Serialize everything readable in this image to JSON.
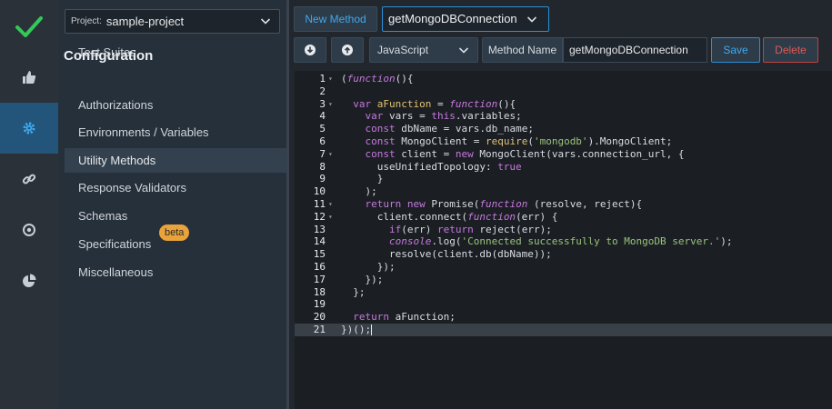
{
  "rail": {
    "items": [
      {
        "icon": "check-icon"
      },
      {
        "icon": "thumbs-up-icon"
      },
      {
        "icon": "gear-icon"
      },
      {
        "icon": "link-icon"
      },
      {
        "icon": "target-icon"
      },
      {
        "icon": "pie-chart-icon"
      }
    ]
  },
  "project": {
    "label": "Project:",
    "value": "sample-project"
  },
  "nav": {
    "heading": "Configuration",
    "items": [
      {
        "label": "Test Suites"
      },
      {
        "label": "Authorizations"
      },
      {
        "label": "Environments / Variables"
      },
      {
        "label": "Utility Methods"
      },
      {
        "label": "Response Validators"
      },
      {
        "label": "Schemas"
      },
      {
        "label": "Specifications",
        "badge": "beta"
      },
      {
        "label": "Miscellaneous"
      }
    ]
  },
  "toolbar": {
    "new_method": "New Method",
    "method_select": "getMongoDBConnection",
    "language": "JavaScript",
    "method_name_label": "Method Name",
    "method_name_value": "getMongoDBConnection",
    "save": "Save",
    "delete": "Delete"
  },
  "editor": {
    "lines": [
      "(function(){",
      "",
      "  var aFunction = function(){",
      "    var vars = this.variables;",
      "    const dbName = vars.db_name;",
      "    const MongoClient = require('mongodb').MongoClient;",
      "    const client = new MongoClient(vars.connection_url, {",
      "      useUnifiedTopology: true",
      "      }",
      "    );",
      "    return new Promise(function (resolve, reject){",
      "      client.connect(function(err) {",
      "        if(err) return reject(err);",
      "        console.log('Connected successfully to MongoDB server.');",
      "        resolve(client.db(dbName));",
      "      });",
      "    });",
      "  };",
      "",
      "  return aFunction;",
      "})();"
    ]
  },
  "colors": {
    "accent": "#3ea9f0",
    "active_rail": "#23557a",
    "check": "#34c759",
    "danger": "#e05a55",
    "beta": "#e8a33a"
  }
}
